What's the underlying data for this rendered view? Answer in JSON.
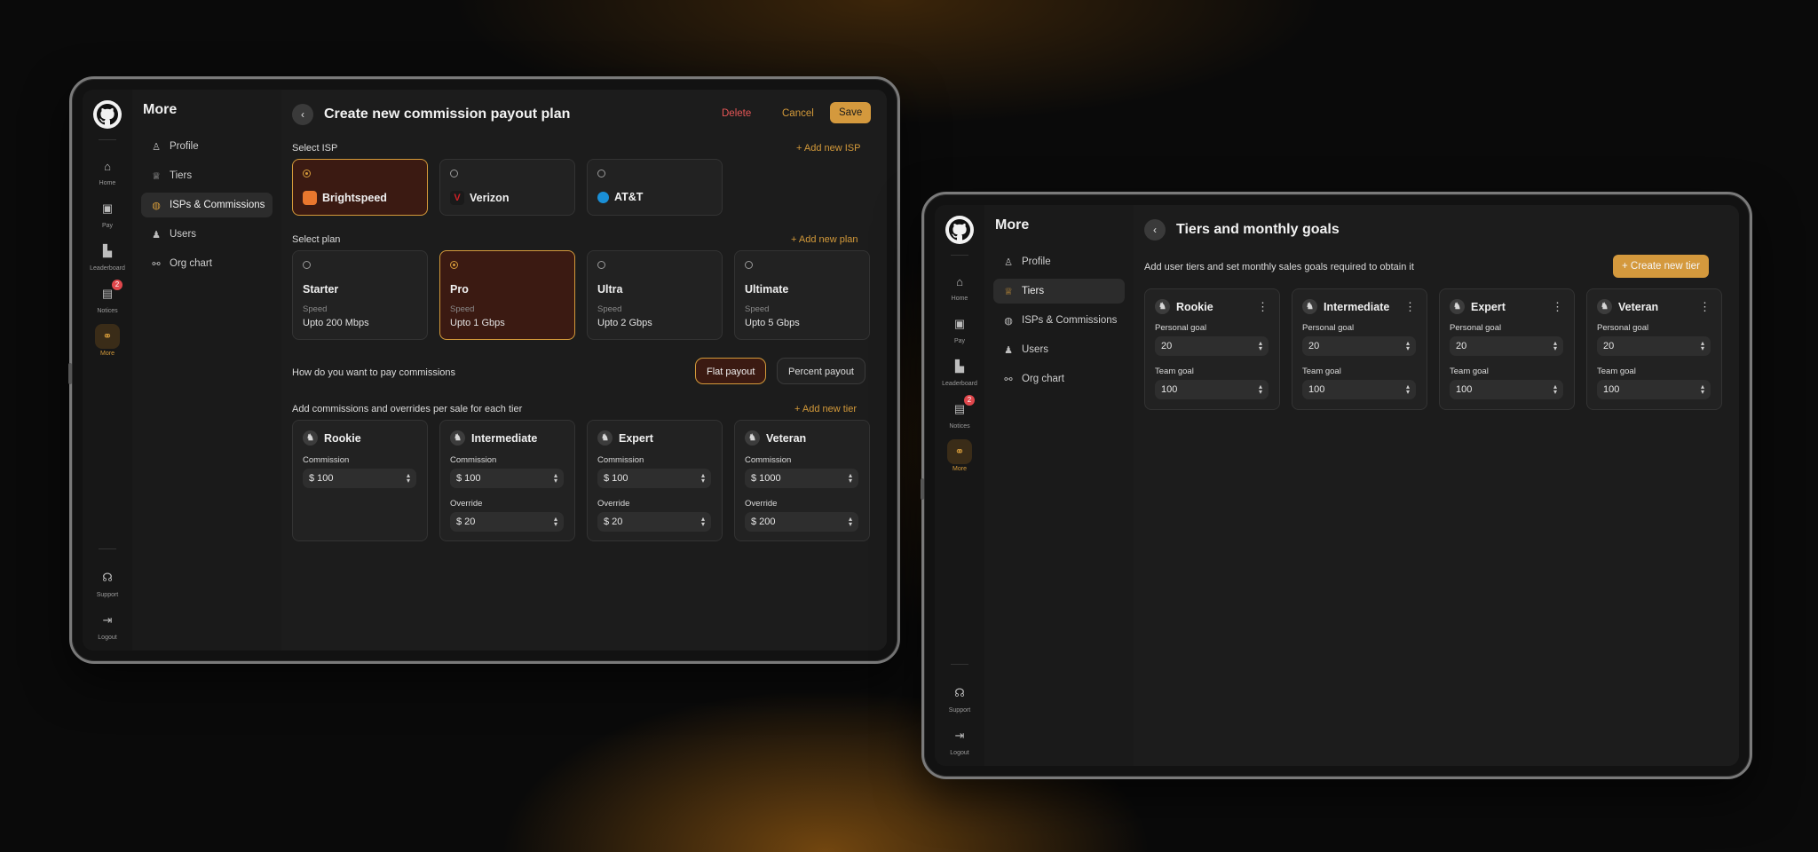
{
  "left": {
    "rail": [
      {
        "label": "Home",
        "icon": "home-icon"
      },
      {
        "label": "Pay",
        "icon": "wallet-icon"
      },
      {
        "label": "Leaderboard",
        "icon": "chart-icon"
      },
      {
        "label": "Notices",
        "icon": "message-icon",
        "badge": "2"
      },
      {
        "label": "More",
        "icon": "link-icon",
        "active": true
      }
    ],
    "rail_bottom": [
      {
        "label": "Support",
        "icon": "headset-icon"
      },
      {
        "label": "Logout",
        "icon": "logout-icon"
      }
    ],
    "menu_title": "More",
    "menu": [
      {
        "label": "Profile",
        "icon": "user-icon"
      },
      {
        "label": "Tiers",
        "icon": "trophy-icon"
      },
      {
        "label": "ISPs & Commissions",
        "icon": "globe-icon",
        "active": true
      },
      {
        "label": "Users",
        "icon": "users-icon"
      },
      {
        "label": "Org chart",
        "icon": "org-icon"
      }
    ],
    "title": "Create new commission payout plan",
    "delete": "Delete",
    "cancel": "Cancel",
    "save": "Save",
    "select_isp": "Select ISP",
    "add_isp": "Add new ISP",
    "isps": [
      {
        "name": "Brightspeed",
        "color": "#e9772e",
        "selected": true
      },
      {
        "name": "Verizon",
        "color": "#cd2026"
      },
      {
        "name": "AT&T",
        "color": "#1a8fd6"
      }
    ],
    "select_plan": "Select plan",
    "add_plan": "Add new plan",
    "plans": [
      {
        "name": "Starter",
        "sub": "Speed",
        "val": "Upto 200 Mbps"
      },
      {
        "name": "Pro",
        "sub": "Speed",
        "val": "Upto 1 Gbps",
        "selected": true
      },
      {
        "name": "Ultra",
        "sub": "Speed",
        "val": "Upto 2 Gbps"
      },
      {
        "name": "Ultimate",
        "sub": "Speed",
        "val": "Upto 5 Gbps"
      }
    ],
    "pay_q": "How do you want to pay commissions",
    "flat": "Flat payout",
    "percent": "Percent payout",
    "add_comm": "Add  commissions and overrides per sale for each tier",
    "add_tier": "Add new tier",
    "commission_label": "Commission",
    "override_label": "Override",
    "tiers": [
      {
        "name": "Rookie",
        "commission": "$ 100"
      },
      {
        "name": "Intermediate",
        "commission": "$ 100",
        "override": "$ 20"
      },
      {
        "name": "Expert",
        "commission": "$ 100",
        "override": "$ 20"
      },
      {
        "name": "Veteran",
        "commission": "$ 1000",
        "override": "$ 200"
      }
    ]
  },
  "right": {
    "rail": [
      {
        "label": "Home",
        "icon": "home-icon"
      },
      {
        "label": "Pay",
        "icon": "wallet-icon"
      },
      {
        "label": "Leaderboard",
        "icon": "chart-icon"
      },
      {
        "label": "Notices",
        "icon": "message-icon",
        "badge": "2"
      },
      {
        "label": "More",
        "icon": "link-icon",
        "active": true
      }
    ],
    "rail_bottom": [
      {
        "label": "Support",
        "icon": "headset-icon"
      },
      {
        "label": "Logout",
        "icon": "logout-icon"
      }
    ],
    "menu_title": "More",
    "menu": [
      {
        "label": "Profile",
        "icon": "user-icon"
      },
      {
        "label": "Tiers",
        "icon": "trophy-icon",
        "active": true
      },
      {
        "label": "ISPs & Commissions",
        "icon": "globe-icon"
      },
      {
        "label": "Users",
        "icon": "users-icon"
      },
      {
        "label": "Org chart",
        "icon": "org-icon"
      }
    ],
    "title": "Tiers and monthly goals",
    "subtitle": "Add user tiers  and set monthly sales goals required to obtain it",
    "create": "Create new tier",
    "personal_label": "Personal goal",
    "team_label": "Team goal",
    "tiers": [
      {
        "name": "Rookie",
        "personal": "20",
        "team": "100"
      },
      {
        "name": "Intermediate",
        "personal": "20",
        "team": "100"
      },
      {
        "name": "Expert",
        "personal": "20",
        "team": "100"
      },
      {
        "name": "Veteran",
        "personal": "20",
        "team": "100"
      }
    ]
  }
}
